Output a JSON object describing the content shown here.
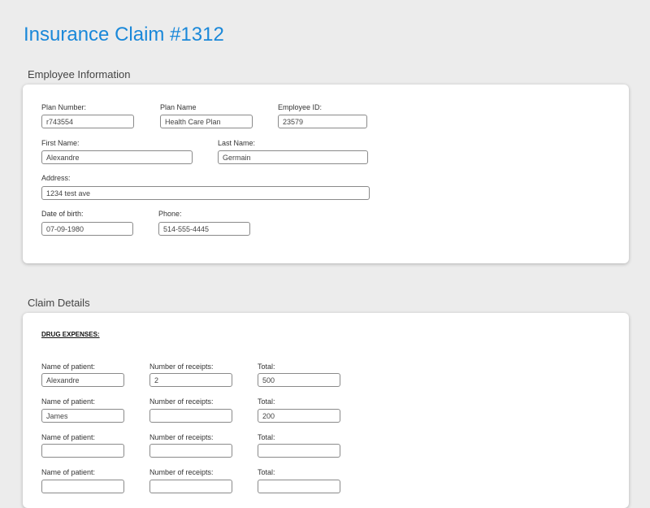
{
  "page": {
    "title": "Insurance Claim #1312"
  },
  "employee_section": {
    "title": "Employee Information",
    "plan_number": {
      "label": "Plan Number:",
      "value": "r743554"
    },
    "plan_name": {
      "label": "Plan Name",
      "value": "Health Care Plan"
    },
    "employee_id": {
      "label": "Employee ID:",
      "value": "23579"
    },
    "first_name": {
      "label": "First Name:",
      "value": "Alexandre"
    },
    "last_name": {
      "label": "Last Name:",
      "value": "Germain"
    },
    "address": {
      "label": "Address:",
      "value": "1234 test ave"
    },
    "dob": {
      "label": "Date of birth:",
      "value": "07-09-1980"
    },
    "phone": {
      "label": "Phone:",
      "value": "514-555-4445"
    }
  },
  "claim_section": {
    "title": "Claim Details",
    "drug_expenses_heading": "DRUG EXPENSES:",
    "rows": [
      {
        "patient_label": "Name of patient:",
        "patient": "Alexandre",
        "receipts_label": "Number of receipts:",
        "receipts": "2",
        "total_label": "Total:",
        "total": "500"
      },
      {
        "patient_label": "Name of patient:",
        "patient": "James",
        "receipts_label": "Number of receipts:",
        "receipts": "",
        "total_label": "Total:",
        "total": "200"
      },
      {
        "patient_label": "Name of patient:",
        "patient": "",
        "receipts_label": "Number of receipts:",
        "receipts": "",
        "total_label": "Total:",
        "total": ""
      },
      {
        "patient_label": "Name of patient:",
        "patient": "",
        "receipts_label": "Number of receipts:",
        "receipts": "",
        "total_label": "Total:",
        "total": ""
      }
    ]
  }
}
